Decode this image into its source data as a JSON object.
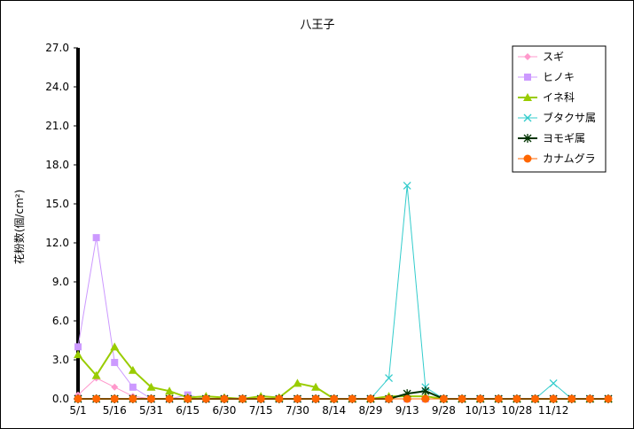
{
  "chart_data": {
    "type": "line",
    "title": "八王子",
    "xlabel": "",
    "ylabel": "花粉数(個/cm²)",
    "ylim": [
      0,
      27
    ],
    "yticks": [
      "0.0",
      "3.0",
      "6.0",
      "9.0",
      "12.0",
      "15.0",
      "18.0",
      "21.0",
      "24.0",
      "27.0"
    ],
    "xtick_labels": [
      "5/1",
      "5/16",
      "5/31",
      "6/15",
      "6/30",
      "7/15",
      "7/30",
      "8/14",
      "8/29",
      "9/13",
      "9/28",
      "10/13",
      "10/28",
      "11/12"
    ],
    "x_count": 30,
    "grid": false,
    "legend_position": "top-right",
    "series": [
      {
        "name": "スギ",
        "color": "#ff99cc",
        "marker": "diamond",
        "width": 1,
        "values": [
          0.3,
          1.6,
          0.9,
          0.2,
          0,
          0,
          0,
          0,
          0,
          0,
          0,
          0,
          0,
          0,
          0,
          0,
          0,
          0,
          0,
          0,
          0,
          0,
          0,
          0,
          0,
          0,
          0,
          0,
          0,
          0
        ]
      },
      {
        "name": "ヒノキ",
        "color": "#cc99ff",
        "marker": "square",
        "width": 1,
        "values": [
          4.0,
          12.4,
          2.8,
          0.9,
          0,
          0,
          0.3,
          0,
          0,
          0,
          0,
          0,
          0,
          0,
          0,
          0,
          0,
          0,
          0,
          0,
          0,
          0,
          0,
          0,
          0,
          0,
          0,
          0,
          0,
          0
        ]
      },
      {
        "name": "イネ科",
        "color": "#99cc00",
        "marker": "triangle",
        "width": 2,
        "values": [
          3.4,
          1.8,
          4.0,
          2.2,
          0.9,
          0.6,
          0.1,
          0.2,
          0.1,
          0,
          0.2,
          0.1,
          1.2,
          0.9,
          0,
          0,
          0,
          0.2,
          0.2,
          0.2,
          0,
          0,
          0,
          0,
          0,
          0,
          0,
          0,
          0,
          0
        ]
      },
      {
        "name": "ブタクサ属",
        "color": "#33cccc",
        "marker": "x",
        "width": 1,
        "values": [
          0,
          0,
          0,
          0,
          0,
          0,
          0,
          0,
          0,
          0,
          0,
          0,
          0,
          0,
          0,
          0,
          0,
          1.6,
          16.4,
          0.9,
          0,
          0,
          0,
          0,
          0,
          0,
          1.2,
          0,
          0,
          0
        ]
      },
      {
        "name": "ヨモギ属",
        "color": "#003300",
        "marker": "star",
        "width": 2,
        "values": [
          0,
          0,
          0,
          0,
          0,
          0,
          0,
          0,
          0,
          0,
          0,
          0,
          0,
          0,
          0,
          0,
          0,
          0,
          0.4,
          0.6,
          0,
          0,
          0,
          0,
          0,
          0,
          0,
          0,
          0,
          0
        ]
      },
      {
        "name": "カナムグラ",
        "color": "#ff6600",
        "marker": "circle",
        "width": 1,
        "values": [
          0,
          0,
          0,
          0,
          0,
          0,
          0,
          0,
          0,
          0,
          0,
          0,
          0,
          0,
          0,
          0,
          0,
          0,
          0,
          0,
          0,
          0,
          0,
          0,
          0,
          0,
          0,
          0,
          0,
          0
        ]
      }
    ]
  }
}
